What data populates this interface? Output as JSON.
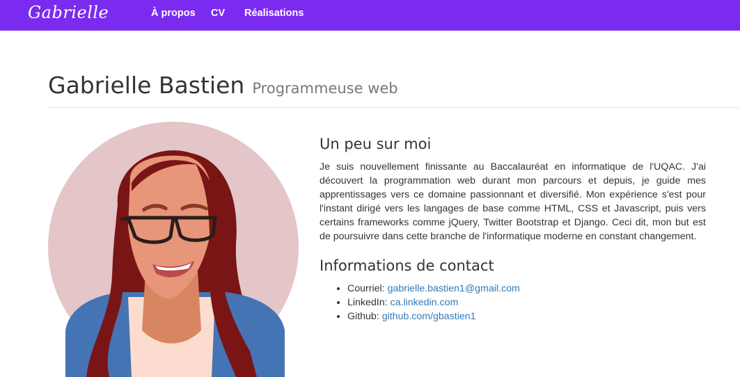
{
  "navbar": {
    "brand": "Gabrielle",
    "links": [
      "À propos",
      "CV",
      "Réalisations"
    ],
    "color": "#7b2bf0"
  },
  "header": {
    "name": "Gabrielle Bastien",
    "subtitle": "Programmeuse web"
  },
  "about": {
    "title": "Un peu sur moi",
    "text": "Je suis nouvellement finissante au Baccalauréat en informatique de l'UQAC. J'ai découvert la programmation web durant mon parcours et depuis, je guide mes apprentissages vers ce domaine passionnant et diversifié. Mon expérience s'est pour l'instant dirigé vers les langages de base comme HTML, CSS et Javascript, puis vers certains frameworks comme jQuery, Twitter Bootstrap et Django. Ceci dit, mon but est de poursuivre dans cette branche de l'informatique moderne en constant changement."
  },
  "contact": {
    "title": "Informations de contact",
    "items": [
      {
        "label": "Courriel:",
        "link": "gabrielle.bastien1@gmail.com"
      },
      {
        "label": "LinkedIn:",
        "link": "ca.linkedin.com"
      },
      {
        "label": "Github:",
        "link": "github.com/gbastien1"
      }
    ],
    "link_color": "#337ab7"
  }
}
